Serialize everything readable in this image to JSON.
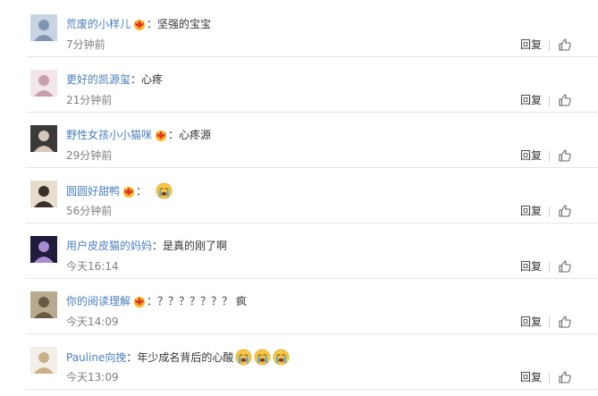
{
  "comments": [
    {
      "user": "荒废的小样儿",
      "colon": "：",
      "text": "坚强的宝宝",
      "emoji_count": 0,
      "time": "7分钟前",
      "reply_label": "回复",
      "has_badge": true,
      "avatar_colors": [
        "#c8d4e2",
        "#7f95b0"
      ]
    },
    {
      "user": "更好的凯源玺",
      "colon": "：",
      "text": "心疼",
      "emoji_count": 0,
      "time": "21分钟前",
      "reply_label": "回复",
      "has_badge": false,
      "avatar_colors": [
        "#f2e6ea",
        "#c7a0ad"
      ]
    },
    {
      "user": "野性女孩小小猫咪",
      "colon": "：",
      "text": "心疼源",
      "emoji_count": 0,
      "time": "29分钟前",
      "reply_label": "回复",
      "has_badge": true,
      "avatar_colors": [
        "#3a3a3a",
        "#d8c6b8"
      ]
    },
    {
      "user": "圆圆好甜鸭",
      "colon": "：",
      "text": "",
      "emoji_count": 1,
      "time": "56分钟前",
      "reply_label": "回复",
      "has_badge": true,
      "avatar_colors": [
        "#e8dccc",
        "#3a302a"
      ]
    },
    {
      "user": "用户皮皮猫的妈妈",
      "colon": "：",
      "text": "是真的刚了啊",
      "emoji_count": 0,
      "time": "今天16:14",
      "reply_label": "回复",
      "has_badge": false,
      "avatar_colors": [
        "#1f1d3a",
        "#a88bd2"
      ]
    },
    {
      "user": "你的阅读理解",
      "colon": "：",
      "text": "？？？？？？？ 疯",
      "emoji_count": 0,
      "time": "今天14:09",
      "reply_label": "回复",
      "has_badge": true,
      "avatar_colors": [
        "#b9a98f",
        "#6a5a45"
      ]
    },
    {
      "user": "Pauline向挽",
      "colon": "：",
      "text": "年少成名背后的心酸",
      "emoji_count": 3,
      "time": "今天13:09",
      "reply_label": "回复",
      "has_badge": false,
      "avatar_colors": [
        "#f4efe6",
        "#c9b18a"
      ]
    }
  ],
  "colors": {
    "username": "#4b7fbd",
    "text": "#333333",
    "time": "#808080",
    "divider": "#e4e4e4",
    "badge": "#f9b51e",
    "emoji": "#f7c744",
    "emoji_tears": "#4fa8e8"
  },
  "icons": {
    "badge": "vip-crown-badge-icon",
    "emoji": "crying-face-emoji-icon",
    "like": "thumbs-up-icon"
  }
}
